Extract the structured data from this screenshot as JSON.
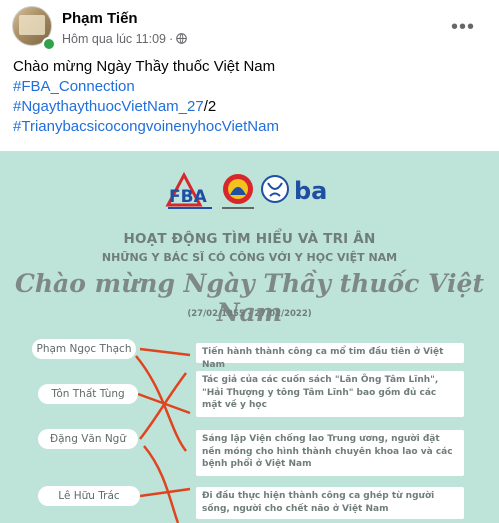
{
  "post": {
    "author": "Phạm Tiến",
    "timestamp": "Hôm qua lúc 11:09",
    "separator": "·",
    "privacy_icon": "globe-icon",
    "more_icon": "more-options-icon",
    "more_glyph": "•••"
  },
  "caption": {
    "line1": "Chào mừng Ngày Thầy thuốc Việt Nam",
    "hashtag1": "#FBA_Connection",
    "hashtag2": "#NgaythaythuocVietNam_27",
    "hashtag2_suffix": "/2",
    "hashtag3": "#TrianybacsicocongvoinenyhocVietNam"
  },
  "image": {
    "title": "HOẠT ĐỘNG TÌM HIỂU VÀ TRI ÂN",
    "subtitle": "NHỮNG Y BÁC SĨ CÓ CÔNG VỚI Y HỌC VIỆT NAM",
    "script_title": "Chào mừng Ngày Thầy thuốc Việt Nam",
    "dates": "(27/02/1955 - 27/02/2022)",
    "names": [
      "Phạm Ngọc Thạch",
      "Tôn Thất Tùng",
      "Đặng Văn Ngữ",
      "Lê Hữu Trác"
    ],
    "facts": [
      "Tiến hành thành công ca mổ tim đầu tiên ở Việt Nam",
      "Tác giả của các cuốn sách \"Lãn Ông Tâm Lĩnh\", \"Hải Thượng y tông Tâm Lĩnh\" bao gồm đủ các mặt về y học",
      "Sáng lập Viện chống lao Trung ương, người đặt nền móng cho hình thành chuyên khoa lao và các bệnh phổi ở Việt Nam",
      "Đi đầu thực hiện thành công ca ghép từ người sống, người cho chết não ở Việt Nam"
    ],
    "colors": {
      "background": "#bee3d8",
      "cross_lines": "#e0441f",
      "fba_blue": "#1f4fa3",
      "fba_red": "#d8262d"
    }
  }
}
